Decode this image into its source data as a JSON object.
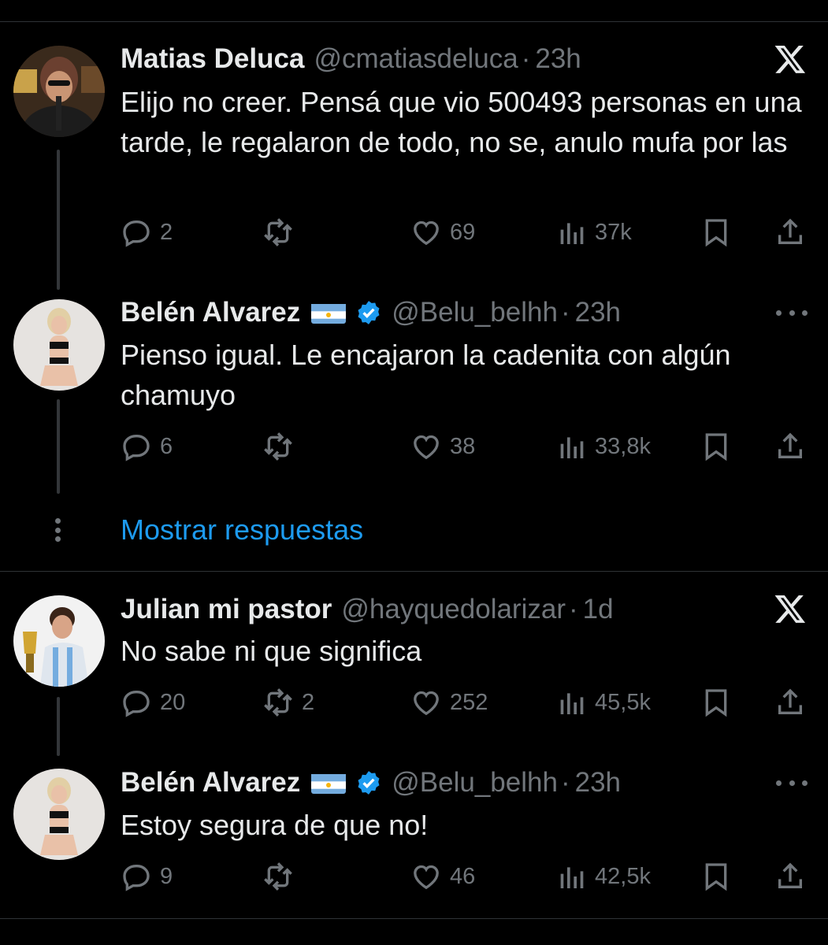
{
  "colors": {
    "background": "#000000",
    "text": "#e7e9ea",
    "secondary": "#71767b",
    "accent": "#1d9bf0",
    "divider": "#2f3336"
  },
  "tweets": [
    {
      "name": "Matias Deluca",
      "handle": "@cmatiasdeluca",
      "dot": "·",
      "time": "23h",
      "corner_icon": "x-logo-icon",
      "text": "Elijo no creer. Pensá que vio 500493 personas en una tarde, le regalaron de todo, no se, anulo mufa por las",
      "replies": "2",
      "retweets": "",
      "likes": "69",
      "views": "37k"
    },
    {
      "name": "Belén Alvarez",
      "handle": "@Belu_belhh",
      "dot": "·",
      "time": "23h",
      "corner_icon": "more-icon",
      "text": "Pienso igual. Le encajaron la cadenita con algún chamuyo",
      "replies": "6",
      "retweets": "",
      "likes": "38",
      "views": "33,8k"
    },
    {
      "name": "Julian mi pastor",
      "handle": "@hayquedolarizar",
      "dot": "·",
      "time": "1d",
      "corner_icon": "x-logo-icon",
      "text": "No sabe ni que significa",
      "replies": "20",
      "retweets": "2",
      "likes": "252",
      "views": "45,5k"
    },
    {
      "name": "Belén Alvarez",
      "handle": "@Belu_belhh",
      "dot": "·",
      "time": "23h",
      "corner_icon": "more-icon",
      "text": "Estoy segura de que no!",
      "replies": "9",
      "retweets": "",
      "likes": "46",
      "views": "42,5k"
    }
  ],
  "show_replies_label": "Mostrar respuestas"
}
